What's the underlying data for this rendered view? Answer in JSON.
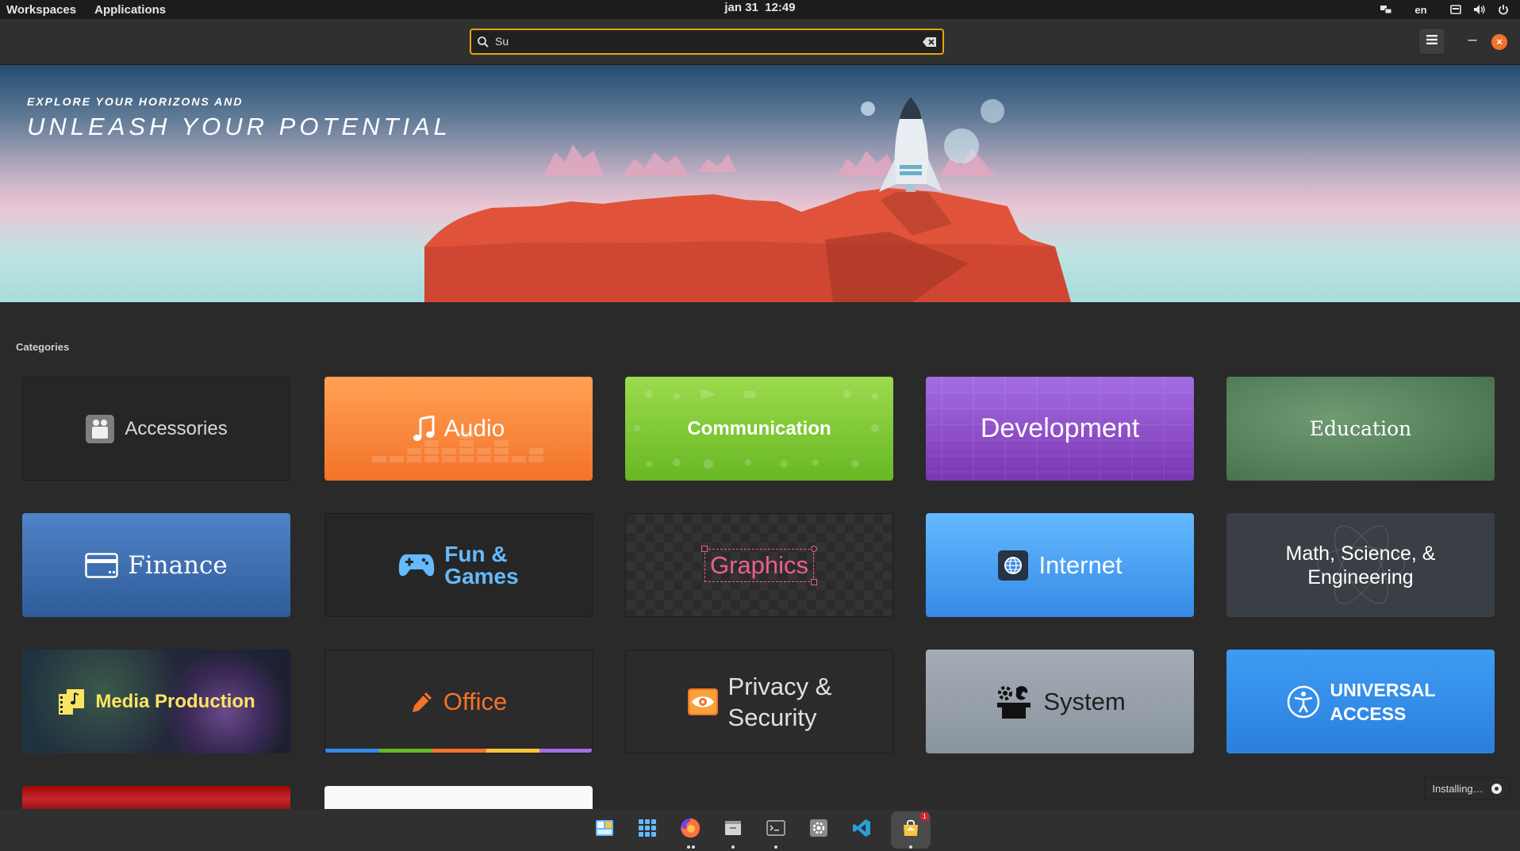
{
  "panel": {
    "workspaces": "Workspaces",
    "applications": "Applications",
    "date": "jan 31",
    "time": "12:49",
    "language": "en",
    "indicators": [
      "network-icon",
      "keyboard-icon",
      "volume-icon",
      "power-icon"
    ]
  },
  "header": {
    "search_value": "Su",
    "menu_icon": "menu-icon",
    "minimize_label": "–",
    "close_label": "×"
  },
  "banner": {
    "line1": "EXPLORE YOUR HORIZONS AND",
    "line2": "UNLEASH YOUR POTENTIAL"
  },
  "categories": {
    "title": "Categories",
    "accessories": "Accessories",
    "audio": "Audio",
    "communication": "Communication",
    "development": "Development",
    "education": "Education",
    "finance": "Finance",
    "fun_line1": "Fun &",
    "fun_line2": "Games",
    "graphics": "Graphics",
    "internet": "Internet",
    "math_line1": "Math, Science, &",
    "math_line2": "Engineering",
    "media": "Media Production",
    "office": "Office",
    "privacy_line1": "Privacy &",
    "privacy_line2": "Security",
    "system": "System",
    "ua_line1": "UNIVERSAL",
    "ua_line2": "ACCESS"
  },
  "status": {
    "installing": "Installing…"
  },
  "dock": {
    "apps": [
      "multitasking-view",
      "applications-menu",
      "firefox",
      "files",
      "terminal",
      "system-settings",
      "visual-studio-code",
      "appcenter"
    ],
    "appcenter_badge": "1"
  },
  "colors": {
    "accent": "#e5a50a",
    "audio": "#f37329",
    "communication": "#68b723",
    "development": "#7a36b1",
    "finance": "#2f5c99",
    "internet": "#3689e6",
    "graphics_text": "#ed5e8b",
    "media_text": "#fce463"
  }
}
